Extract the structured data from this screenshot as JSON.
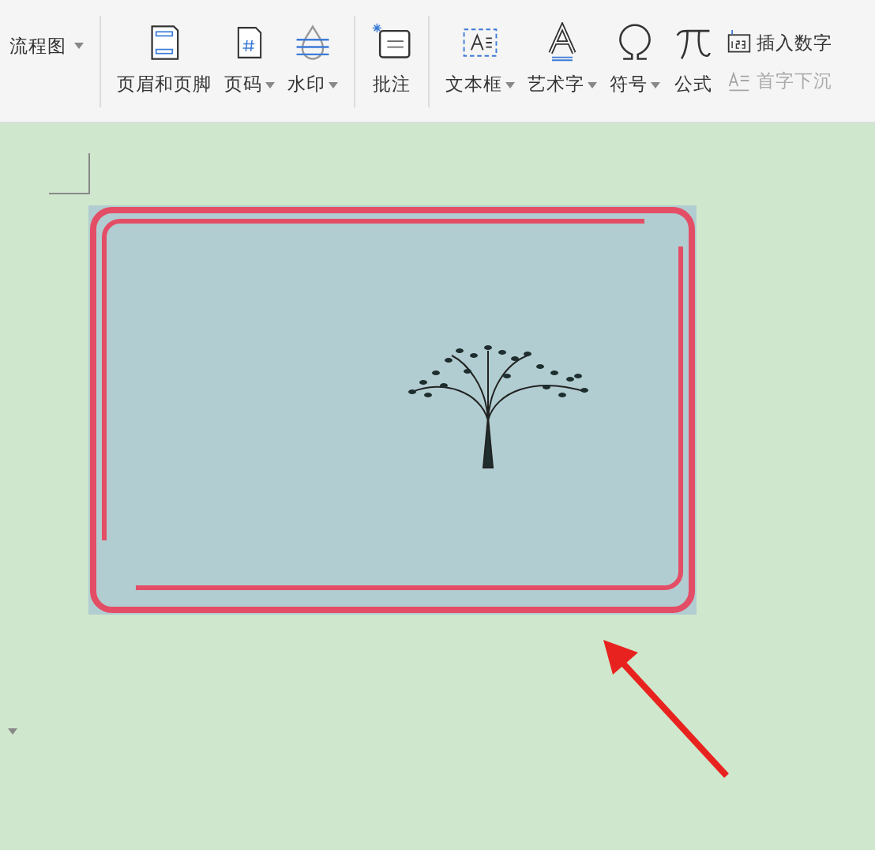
{
  "ribbon": {
    "groups": [
      {
        "items": [
          {
            "kind": "small",
            "label": "流程图",
            "dropdown": true,
            "disabled": false
          }
        ]
      },
      {
        "items": [
          {
            "kind": "large",
            "label": "页眉和页脚",
            "dropdown": false,
            "disabled": false
          },
          {
            "kind": "large",
            "label": "页码",
            "dropdown": true,
            "disabled": false
          },
          {
            "kind": "large",
            "label": "水印",
            "dropdown": true,
            "disabled": false
          }
        ]
      },
      {
        "items": [
          {
            "kind": "large",
            "label": "批注",
            "dropdown": false,
            "disabled": false
          }
        ]
      },
      {
        "items": [
          {
            "kind": "large",
            "label": "文本框",
            "dropdown": true,
            "disabled": false
          },
          {
            "kind": "large",
            "label": "艺术字",
            "dropdown": true,
            "disabled": false
          },
          {
            "kind": "large",
            "label": "符号",
            "dropdown": true,
            "disabled": false
          },
          {
            "kind": "large",
            "label": "公式",
            "dropdown": false,
            "disabled": false
          },
          {
            "kind": "stack",
            "items": [
              {
                "label": "插入数字",
                "disabled": false
              },
              {
                "label": "首字下沉",
                "disabled": true
              }
            ]
          }
        ]
      }
    ]
  }
}
